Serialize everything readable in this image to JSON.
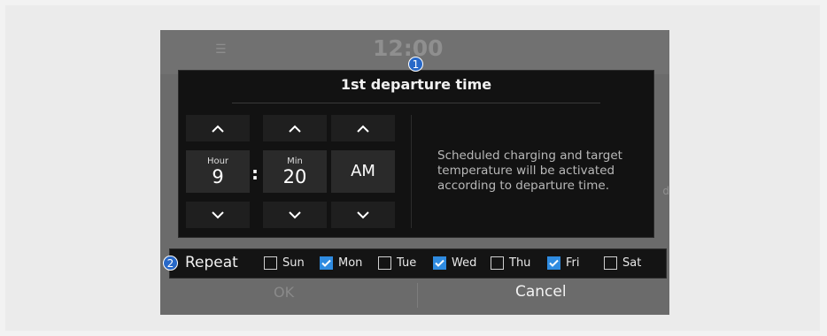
{
  "background": {
    "menu_icon": "menu-icon",
    "clock": "12:00",
    "ok_label": "OK",
    "cancel_label": "Cancel",
    "edge_char": "d"
  },
  "dialog": {
    "title": "1st departure time",
    "hour": {
      "label": "Hour",
      "value": "9"
    },
    "minute": {
      "label": "Min",
      "value": "20"
    },
    "separator": ":",
    "ampm": "AM",
    "description": "Scheduled charging and target temperature will be activated according to departure time."
  },
  "repeat": {
    "label": "Repeat",
    "days": [
      {
        "label": "Sun",
        "checked": false
      },
      {
        "label": "Mon",
        "checked": true
      },
      {
        "label": "Tue",
        "checked": false
      },
      {
        "label": "Wed",
        "checked": true
      },
      {
        "label": "Thu",
        "checked": false
      },
      {
        "label": "Fri",
        "checked": true
      },
      {
        "label": "Sat",
        "checked": false
      }
    ]
  },
  "callouts": {
    "one": "1",
    "two": "2"
  },
  "colors": {
    "accent": "#2f8be0",
    "callout": "#2768c8",
    "dialog_bg": "#121212"
  }
}
